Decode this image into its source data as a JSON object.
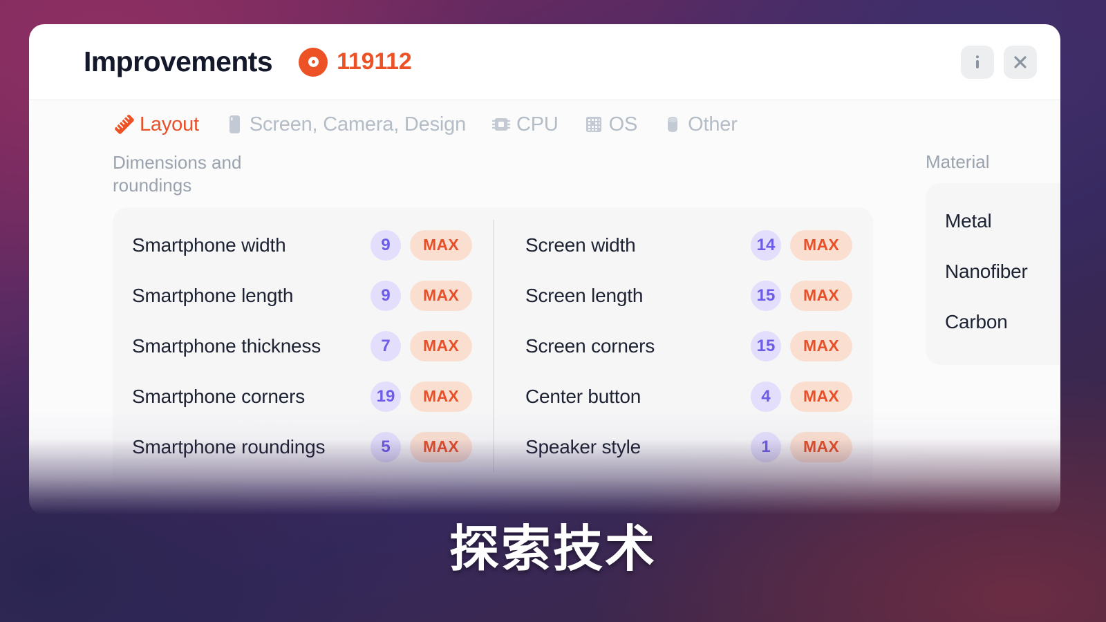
{
  "header": {
    "title": "Improvements",
    "coin_icon": "coin-icon",
    "coin_amount": "119112",
    "info_label": "i",
    "close_label": "×"
  },
  "tabs": [
    {
      "label": "Layout",
      "icon": "ruler-icon",
      "active": true
    },
    {
      "label": "Screen, Camera, Design",
      "icon": "smartphone-icon",
      "active": false
    },
    {
      "label": "CPU",
      "icon": "chip-icon",
      "active": false
    },
    {
      "label": "OS",
      "icon": "grid-icon",
      "active": false
    },
    {
      "label": "Other",
      "icon": "capsule-icon",
      "active": false
    }
  ],
  "layout_section": {
    "title": "Dimensions and\nroundings",
    "columns": [
      {
        "rows": [
          {
            "name": "Smartphone width",
            "level": "9",
            "action": "MAX"
          },
          {
            "name": "Smartphone length",
            "level": "9",
            "action": "MAX"
          },
          {
            "name": "Smartphone thickness",
            "level": "7",
            "action": "MAX"
          },
          {
            "name": "Smartphone corners",
            "level": "19",
            "action": "MAX"
          },
          {
            "name": "Smartphone roundings",
            "level": "5",
            "action": "MAX"
          }
        ]
      },
      {
        "rows": [
          {
            "name": "Screen width",
            "level": "14",
            "action": "MAX"
          },
          {
            "name": "Screen length",
            "level": "15",
            "action": "MAX"
          },
          {
            "name": "Screen corners",
            "level": "15",
            "action": "MAX"
          },
          {
            "name": "Center button",
            "level": "4",
            "action": "MAX"
          },
          {
            "name": "Speaker style",
            "level": "1",
            "action": "MAX"
          }
        ]
      }
    ]
  },
  "material_section": {
    "title": "Material",
    "rows": [
      {
        "name": "Metal"
      },
      {
        "name": "Nanofiber"
      },
      {
        "name": "Carbon"
      }
    ]
  },
  "caption": "探索技术",
  "colors": {
    "accent_orange": "#e8502a",
    "coin_orange": "#ed5226",
    "badge_purple_bg": "#e2defb",
    "badge_purple_text": "#6c5ce7",
    "max_pill_bg": "#fadfd1",
    "panel_bg": "#f6f6f7",
    "muted_text": "#9aa3ad",
    "title_text": "#13182b"
  }
}
